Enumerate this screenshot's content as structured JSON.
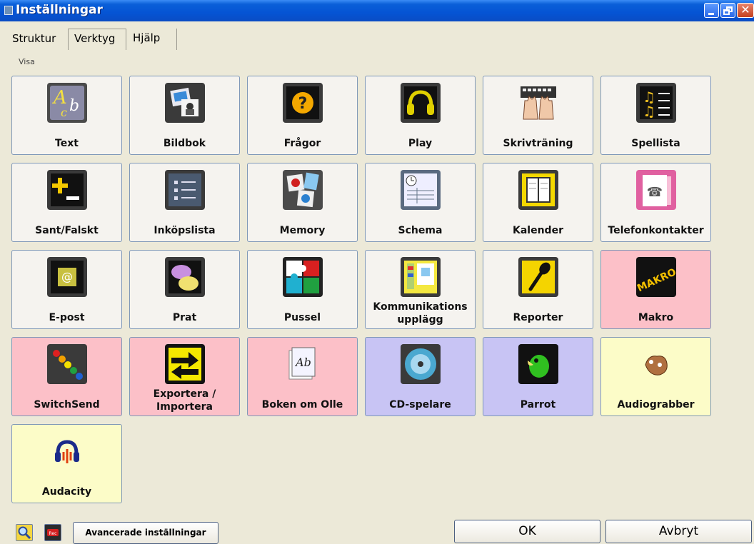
{
  "window": {
    "title": "Inställningar"
  },
  "tabs": [
    "Struktur",
    "Verktyg",
    "Hjälp"
  ],
  "group_label": "Visa",
  "tiles": [
    {
      "label": "Text",
      "icon": "text-ab-icon",
      "color": "neutral"
    },
    {
      "label": "Bildbok",
      "icon": "picture-book-icon",
      "color": "neutral"
    },
    {
      "label": "Frågor",
      "icon": "question-icon",
      "color": "neutral"
    },
    {
      "label": "Play",
      "icon": "headphones-icon",
      "color": "neutral"
    },
    {
      "label": "Skrivträning",
      "icon": "typing-hands-icon",
      "color": "neutral"
    },
    {
      "label": "Spellista",
      "icon": "playlist-icon",
      "color": "neutral"
    },
    {
      "label": "Sant/Falskt",
      "icon": "plus-minus-icon",
      "color": "neutral"
    },
    {
      "label": "Inköpslista",
      "icon": "shopping-list-icon",
      "color": "neutral"
    },
    {
      "label": "Memory",
      "icon": "memory-cards-icon",
      "color": "neutral"
    },
    {
      "label": "Schema",
      "icon": "schedule-icon",
      "color": "neutral"
    },
    {
      "label": "Kalender",
      "icon": "calendar-icon",
      "color": "neutral"
    },
    {
      "label": "Telefonkontakter",
      "icon": "phone-contacts-icon",
      "color": "neutral"
    },
    {
      "label": "E-post",
      "icon": "email-at-icon",
      "color": "neutral"
    },
    {
      "label": "Prat",
      "icon": "chat-bubbles-icon",
      "color": "neutral"
    },
    {
      "label": "Pussel",
      "icon": "puzzle-icon",
      "color": "neutral"
    },
    {
      "label_lines": [
        "Kommunikations",
        "upplägg"
      ],
      "icon": "communication-board-icon",
      "color": "neutral"
    },
    {
      "label": "Reporter",
      "icon": "microphone-icon",
      "color": "neutral"
    },
    {
      "label": "Makro",
      "icon": "makro-icon",
      "icon_text": "MAKRO",
      "color": "pink"
    },
    {
      "label": "SwitchSend",
      "icon": "switch-dots-icon",
      "color": "pink"
    },
    {
      "label_lines": [
        "Exportera /",
        "Importera"
      ],
      "icon": "export-import-arrows-icon",
      "color": "pink"
    },
    {
      "label": "Boken om Olle",
      "icon": "book-ab-icon",
      "color": "pink"
    },
    {
      "label": "CD-spelare",
      "icon": "cd-player-icon",
      "color": "purple"
    },
    {
      "label": "Parrot",
      "icon": "parrot-icon",
      "color": "purple"
    },
    {
      "label": "Audiograbber",
      "icon": "audiograbber-hand-icon",
      "color": "yellow"
    },
    {
      "label": "Audacity",
      "icon": "audacity-headphones-icon",
      "color": "yellow"
    }
  ],
  "bottom": {
    "search_icon": "magnifier-icon",
    "rec_icon": "rec-icon",
    "rec_text": "Rec",
    "advanced_label": "Avancerade inställningar",
    "ok_label": "OK",
    "cancel_label": "Avbryt"
  },
  "colors": {
    "neutral": "#f5f3ef",
    "pink": "#fcc0c8",
    "purple": "#c8c4f4",
    "yellow": "#fcfcc8",
    "titlebar": "#0554d4"
  }
}
